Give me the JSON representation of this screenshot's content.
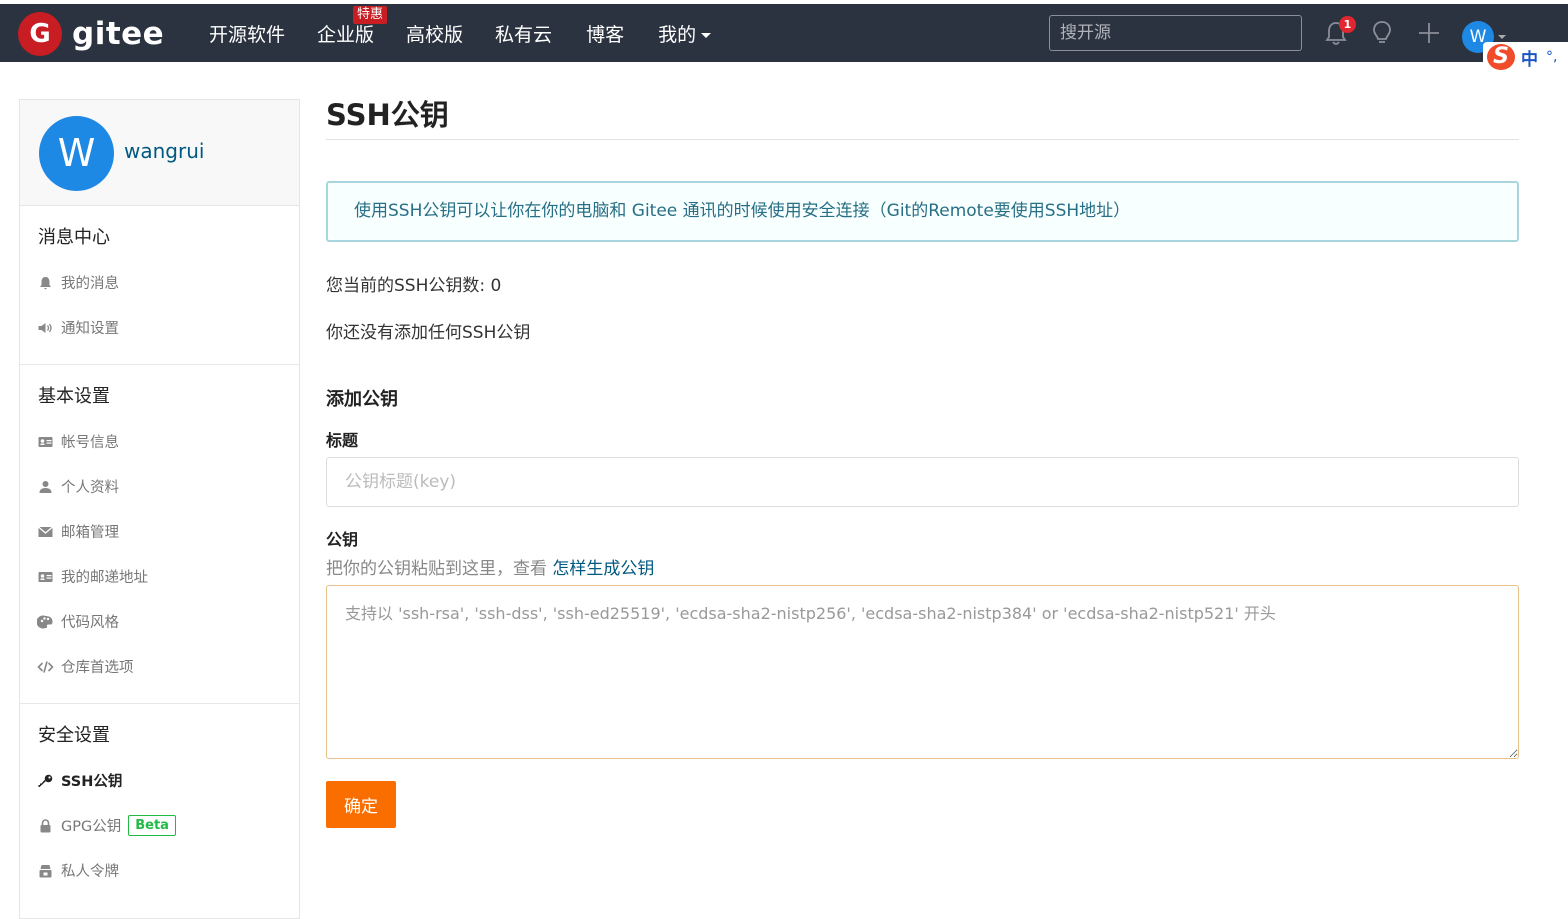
{
  "brand": {
    "name": "gitee",
    "mark": "G"
  },
  "nav": {
    "items": [
      {
        "label": "开源软件"
      },
      {
        "label": "企业版",
        "badge": "特惠"
      },
      {
        "label": "高校版"
      },
      {
        "label": "私有云"
      },
      {
        "label": "博客"
      },
      {
        "label": "我的"
      }
    ],
    "search_placeholder": "搜开源",
    "notification_count": "1",
    "avatar_letter": "W"
  },
  "ime": {
    "logo": "S",
    "mode": "中",
    "punct": "°,"
  },
  "sidebar": {
    "avatar_letter": "W",
    "username": "wangrui",
    "groups": [
      {
        "title": "消息中心",
        "items": [
          {
            "label": "我的消息",
            "icon": "bell-icon"
          },
          {
            "label": "通知设置",
            "icon": "volume-icon"
          }
        ]
      },
      {
        "title": "基本设置",
        "items": [
          {
            "label": "帐号信息",
            "icon": "id-card-icon"
          },
          {
            "label": "个人资料",
            "icon": "user-icon"
          },
          {
            "label": "邮箱管理",
            "icon": "envelope-icon"
          },
          {
            "label": "我的邮递地址",
            "icon": "address-card-icon"
          },
          {
            "label": "代码风格",
            "icon": "palette-icon"
          },
          {
            "label": "仓库首选项",
            "icon": "code-icon"
          }
        ]
      },
      {
        "title": "安全设置",
        "items": [
          {
            "label": "SSH公钥",
            "icon": "key-icon",
            "active": true
          },
          {
            "label": "GPG公钥",
            "icon": "lock-icon",
            "badge": "Beta"
          },
          {
            "label": "私人令牌",
            "icon": "token-icon"
          }
        ]
      }
    ]
  },
  "main": {
    "title": "SSH公钥",
    "info": "使用SSH公钥可以让你在你的电脑和 Gitee 通讯的时候使用安全连接（Git的Remote要使用SSH地址）",
    "count_text": "您当前的SSH公钥数: 0",
    "none_text": "你还没有添加任何SSH公钥",
    "add_title": "添加公钥",
    "title_label": "标题",
    "title_placeholder": "公钥标题(key)",
    "key_label": "公钥",
    "hint_text": "把你的公钥粘贴到这里，查看 ",
    "hint_link": "怎样生成公钥",
    "key_placeholder": "支持以 'ssh-rsa', 'ssh-dss', 'ssh-ed25519', 'ecdsa-sha2-nistp256', 'ecdsa-sha2-nistp384' or 'ecdsa-sha2-nistp521' 开头",
    "submit_label": "确定"
  },
  "colors": {
    "topbar": "#2b3340",
    "brand_red": "#c71d23",
    "accent_orange": "#fa6e00",
    "link": "#005980",
    "beta_green": "#21ba45",
    "avatar_blue": "#1e88e5"
  }
}
